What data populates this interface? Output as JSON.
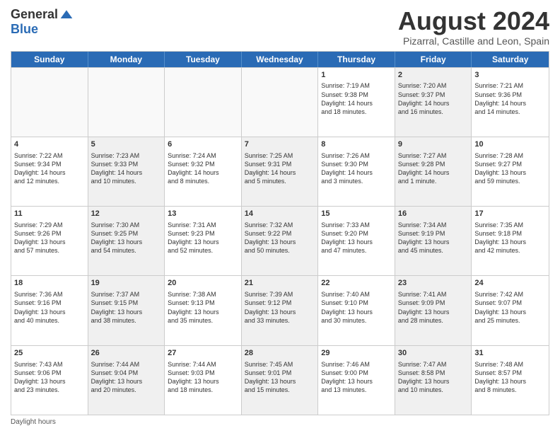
{
  "logo": {
    "general": "General",
    "blue": "Blue"
  },
  "title": "August 2024",
  "subtitle": "Pizarral, Castille and Leon, Spain",
  "days_of_week": [
    "Sunday",
    "Monday",
    "Tuesday",
    "Wednesday",
    "Thursday",
    "Friday",
    "Saturday"
  ],
  "footer": "Daylight hours",
  "weeks": [
    [
      {
        "day": "",
        "info": "",
        "empty": true
      },
      {
        "day": "",
        "info": "",
        "empty": true
      },
      {
        "day": "",
        "info": "",
        "empty": true
      },
      {
        "day": "",
        "info": "",
        "empty": true
      },
      {
        "day": "1",
        "info": "Sunrise: 7:19 AM\nSunset: 9:38 PM\nDaylight: 14 hours\nand 18 minutes.",
        "empty": false
      },
      {
        "day": "2",
        "info": "Sunrise: 7:20 AM\nSunset: 9:37 PM\nDaylight: 14 hours\nand 16 minutes.",
        "empty": false,
        "shaded": true
      },
      {
        "day": "3",
        "info": "Sunrise: 7:21 AM\nSunset: 9:36 PM\nDaylight: 14 hours\nand 14 minutes.",
        "empty": false
      }
    ],
    [
      {
        "day": "4",
        "info": "Sunrise: 7:22 AM\nSunset: 9:34 PM\nDaylight: 14 hours\nand 12 minutes.",
        "empty": false
      },
      {
        "day": "5",
        "info": "Sunrise: 7:23 AM\nSunset: 9:33 PM\nDaylight: 14 hours\nand 10 minutes.",
        "empty": false,
        "shaded": true
      },
      {
        "day": "6",
        "info": "Sunrise: 7:24 AM\nSunset: 9:32 PM\nDaylight: 14 hours\nand 8 minutes.",
        "empty": false
      },
      {
        "day": "7",
        "info": "Sunrise: 7:25 AM\nSunset: 9:31 PM\nDaylight: 14 hours\nand 5 minutes.",
        "empty": false,
        "shaded": true
      },
      {
        "day": "8",
        "info": "Sunrise: 7:26 AM\nSunset: 9:30 PM\nDaylight: 14 hours\nand 3 minutes.",
        "empty": false
      },
      {
        "day": "9",
        "info": "Sunrise: 7:27 AM\nSunset: 9:28 PM\nDaylight: 14 hours\nand 1 minute.",
        "empty": false,
        "shaded": true
      },
      {
        "day": "10",
        "info": "Sunrise: 7:28 AM\nSunset: 9:27 PM\nDaylight: 13 hours\nand 59 minutes.",
        "empty": false
      }
    ],
    [
      {
        "day": "11",
        "info": "Sunrise: 7:29 AM\nSunset: 9:26 PM\nDaylight: 13 hours\nand 57 minutes.",
        "empty": false
      },
      {
        "day": "12",
        "info": "Sunrise: 7:30 AM\nSunset: 9:25 PM\nDaylight: 13 hours\nand 54 minutes.",
        "empty": false,
        "shaded": true
      },
      {
        "day": "13",
        "info": "Sunrise: 7:31 AM\nSunset: 9:23 PM\nDaylight: 13 hours\nand 52 minutes.",
        "empty": false
      },
      {
        "day": "14",
        "info": "Sunrise: 7:32 AM\nSunset: 9:22 PM\nDaylight: 13 hours\nand 50 minutes.",
        "empty": false,
        "shaded": true
      },
      {
        "day": "15",
        "info": "Sunrise: 7:33 AM\nSunset: 9:20 PM\nDaylight: 13 hours\nand 47 minutes.",
        "empty": false
      },
      {
        "day": "16",
        "info": "Sunrise: 7:34 AM\nSunset: 9:19 PM\nDaylight: 13 hours\nand 45 minutes.",
        "empty": false,
        "shaded": true
      },
      {
        "day": "17",
        "info": "Sunrise: 7:35 AM\nSunset: 9:18 PM\nDaylight: 13 hours\nand 42 minutes.",
        "empty": false
      }
    ],
    [
      {
        "day": "18",
        "info": "Sunrise: 7:36 AM\nSunset: 9:16 PM\nDaylight: 13 hours\nand 40 minutes.",
        "empty": false
      },
      {
        "day": "19",
        "info": "Sunrise: 7:37 AM\nSunset: 9:15 PM\nDaylight: 13 hours\nand 38 minutes.",
        "empty": false,
        "shaded": true
      },
      {
        "day": "20",
        "info": "Sunrise: 7:38 AM\nSunset: 9:13 PM\nDaylight: 13 hours\nand 35 minutes.",
        "empty": false
      },
      {
        "day": "21",
        "info": "Sunrise: 7:39 AM\nSunset: 9:12 PM\nDaylight: 13 hours\nand 33 minutes.",
        "empty": false,
        "shaded": true
      },
      {
        "day": "22",
        "info": "Sunrise: 7:40 AM\nSunset: 9:10 PM\nDaylight: 13 hours\nand 30 minutes.",
        "empty": false
      },
      {
        "day": "23",
        "info": "Sunrise: 7:41 AM\nSunset: 9:09 PM\nDaylight: 13 hours\nand 28 minutes.",
        "empty": false,
        "shaded": true
      },
      {
        "day": "24",
        "info": "Sunrise: 7:42 AM\nSunset: 9:07 PM\nDaylight: 13 hours\nand 25 minutes.",
        "empty": false
      }
    ],
    [
      {
        "day": "25",
        "info": "Sunrise: 7:43 AM\nSunset: 9:06 PM\nDaylight: 13 hours\nand 23 minutes.",
        "empty": false
      },
      {
        "day": "26",
        "info": "Sunrise: 7:44 AM\nSunset: 9:04 PM\nDaylight: 13 hours\nand 20 minutes.",
        "empty": false,
        "shaded": true
      },
      {
        "day": "27",
        "info": "Sunrise: 7:44 AM\nSunset: 9:03 PM\nDaylight: 13 hours\nand 18 minutes.",
        "empty": false
      },
      {
        "day": "28",
        "info": "Sunrise: 7:45 AM\nSunset: 9:01 PM\nDaylight: 13 hours\nand 15 minutes.",
        "empty": false,
        "shaded": true
      },
      {
        "day": "29",
        "info": "Sunrise: 7:46 AM\nSunset: 9:00 PM\nDaylight: 13 hours\nand 13 minutes.",
        "empty": false
      },
      {
        "day": "30",
        "info": "Sunrise: 7:47 AM\nSunset: 8:58 PM\nDaylight: 13 hours\nand 10 minutes.",
        "empty": false,
        "shaded": true
      },
      {
        "day": "31",
        "info": "Sunrise: 7:48 AM\nSunset: 8:57 PM\nDaylight: 13 hours\nand 8 minutes.",
        "empty": false
      }
    ]
  ]
}
